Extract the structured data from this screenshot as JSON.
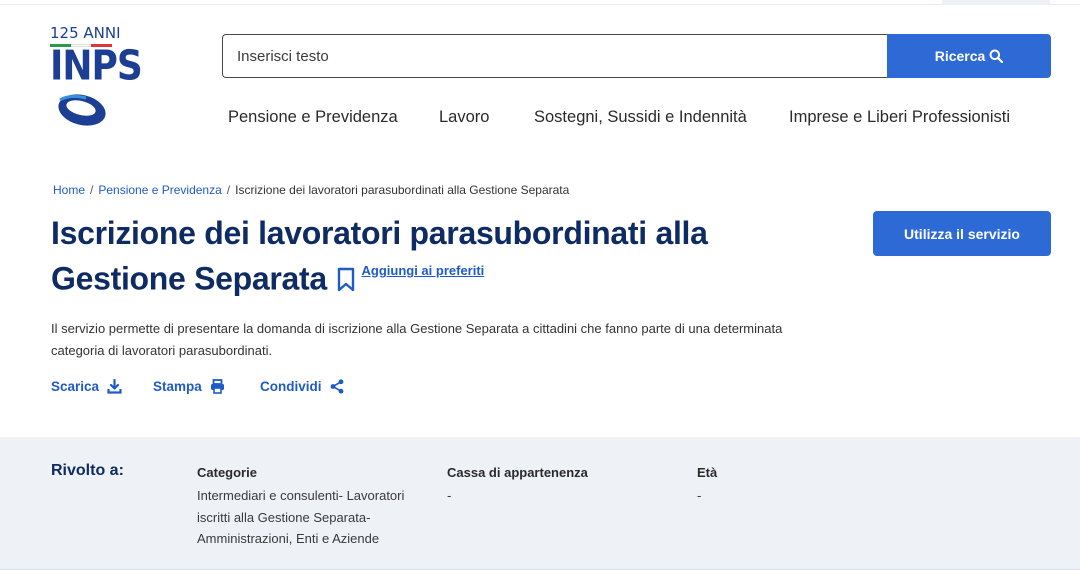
{
  "logo": {
    "anniversary": "125 ANNI",
    "brand": "INPS",
    "flag_colors": [
      "#2e9a48",
      "#ffffff",
      "#e0353b"
    ],
    "brand_color": "#1c3f94"
  },
  "search": {
    "placeholder": "Inserisci testo",
    "button_label": "Ricerca"
  },
  "nav": {
    "items": [
      "Pensione e Previdenza",
      "Lavoro",
      "Sostegni, Sussidi e Indennità",
      "Imprese e Liberi Professionisti"
    ]
  },
  "breadcrumb": {
    "home": "Home",
    "section": "Pensione e Previdenza",
    "current": "Iscrizione dei lavoratori parasubordinati alla Gestione Separata"
  },
  "page": {
    "title_line1": "Iscrizione dei lavoratori parasubordinati alla",
    "title_line2": "Gestione Separata",
    "favorites_label": "Aggiungi ai preferiti",
    "use_service_label": "Utilizza il servizio",
    "description": "Il servizio permette di presentare la domanda di iscrizione alla Gestione Separata a cittadini che fanno parte di una determinata categoria di lavoratori parasubordinati."
  },
  "actions": {
    "download": "Scarica",
    "print": "Stampa",
    "share": "Condividi"
  },
  "target": {
    "title": "Rivolto a:",
    "categories": {
      "label": "Categorie",
      "value": "Intermediari e consulenti- Lavoratori iscritti alla Gestione Separata- Amministrazioni, Enti e Aziende"
    },
    "cassa": {
      "label": "Cassa di appartenenza",
      "value": "-"
    },
    "eta": {
      "label": "Età",
      "value": "-"
    }
  },
  "colors": {
    "primary": "#2d6ad6",
    "link": "#1f5bc6",
    "title": "#0f2b63",
    "band": "#eef1f6"
  },
  "icons": {
    "search": "search-icon",
    "bookmark": "bookmark-icon",
    "download": "download-icon",
    "print": "printer-icon",
    "share": "share-icon"
  }
}
